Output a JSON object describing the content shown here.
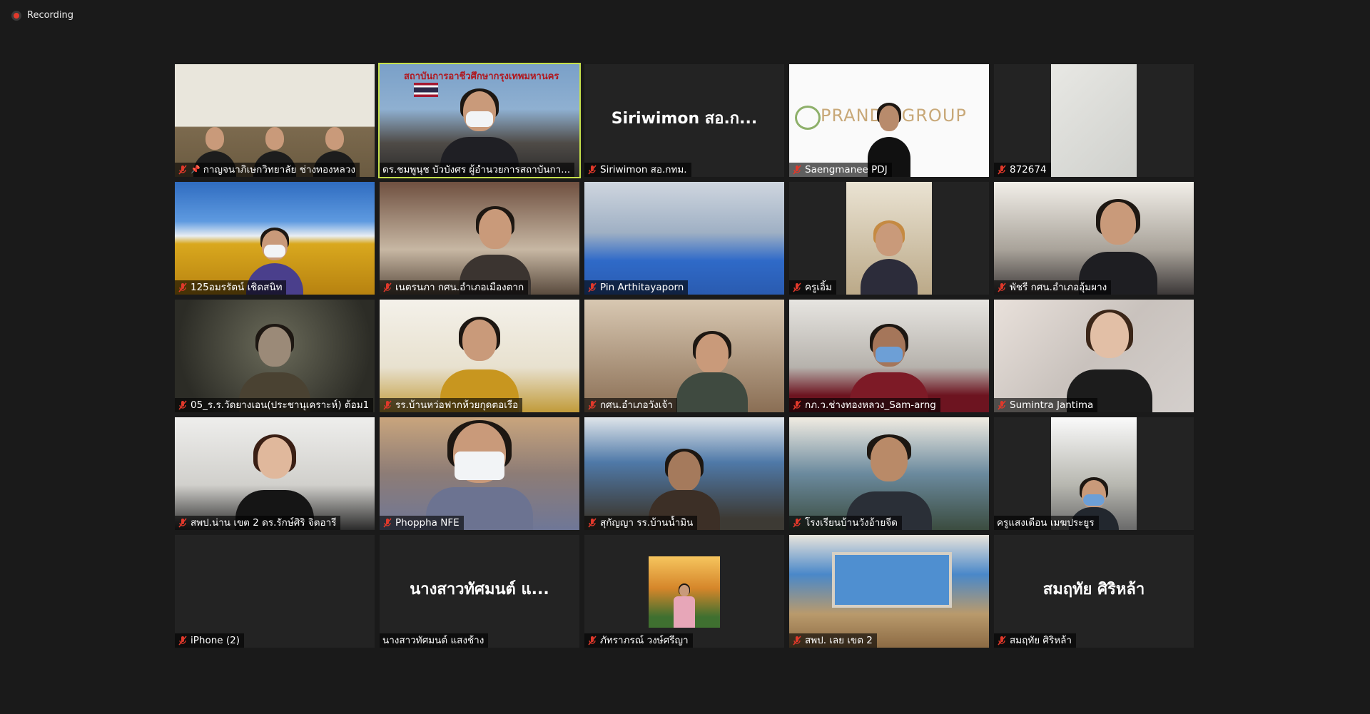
{
  "recording": {
    "label": "Recording",
    "icon": "record-dot-icon",
    "color": "#e0392b"
  },
  "active_speaker_color": "#c6e04a",
  "tiles": [
    {
      "name": "กาญจนาภิเษกวิทยาลัย ช่างทองหลวง",
      "muted": true,
      "pinned": true,
      "video": "meeting-stage"
    },
    {
      "name": "ดร.ชมพูนุช บัวบังศร ผู้อำนวยการสถาบันกา...",
      "muted": false,
      "active": true,
      "video": "speaker-thai-flag",
      "banner": "สถาบันการอาชีวศึกษากรุงเทพมหานคร"
    },
    {
      "name": "Siriwimon สอ.กทม.",
      "muted": true,
      "display_name": "Siriwimon สอ.ก...",
      "video": "none"
    },
    {
      "name": "Saengmanee PDJ",
      "muted": true,
      "video": "pranda-group",
      "logo": "PRANDA GROUP"
    },
    {
      "name": "872674",
      "muted": true,
      "video": "ceiling"
    },
    {
      "name": "125อมรรัตน์ เชิดสนิท",
      "muted": true,
      "video": "sunflower"
    },
    {
      "name": "เนตรนภา กศน.อำเภอเมืองตาก",
      "muted": true,
      "video": "office"
    },
    {
      "name": "Pin Arthitayaporn",
      "muted": true,
      "video": "library"
    },
    {
      "name": "ครูเอิ้ม",
      "muted": true,
      "video": "room"
    },
    {
      "name": "พัชรี กศน.อำเภออุ้มผาง",
      "muted": true,
      "video": "room-glasses"
    },
    {
      "name": "05_ร.ร.วัดยางเอน(ประชานุเคราะห์) ต้อม1",
      "muted": true,
      "video": "blurred"
    },
    {
      "name": "รร.บ้านหว่อฟากห้วยกุดตอเรือ",
      "muted": true,
      "video": "tree-wall"
    },
    {
      "name": "กศน.อำเภอวังเจ้า",
      "muted": true,
      "video": "poster-room"
    },
    {
      "name": "กภ.ว.ช่างทองหลวง_Sam-arng",
      "muted": true,
      "video": "office-chair"
    },
    {
      "name": "Sumintra Jantima",
      "muted": true,
      "video": "red-wall"
    },
    {
      "name": "สพป.น่าน เขต 2 ดร.รักษ์ศิริ จิตอารี",
      "muted": true,
      "video": "woman-white"
    },
    {
      "name": "Phoppha NFE",
      "muted": true,
      "video": "glasses-mask"
    },
    {
      "name": "สุกัญญา รร.บ้านน้ำมิน",
      "muted": true,
      "video": "blue-room"
    },
    {
      "name": "โรงเรียนบ้านวังอ้ายจีด",
      "muted": true,
      "video": "classroom"
    },
    {
      "name": "ครูแสงเดือน เมฆประยูร",
      "muted": false,
      "video": "ceiling-mask"
    },
    {
      "name": "iPhone (2)",
      "muted": true,
      "video": "none-blank"
    },
    {
      "name": "นางสาวทัศมนต์ แสงช้าง",
      "muted": false,
      "display_name": "นางสาวทัศมนต์ แ...",
      "video": "none"
    },
    {
      "name": "ภัทราภรณ์ วงษ์ศรีญา",
      "muted": true,
      "video": "sunset-avatar"
    },
    {
      "name": "สพป. เลย เขต 2",
      "muted": true,
      "video": "hall"
    },
    {
      "name": "สมฤทัย ศิริหล้า",
      "muted": true,
      "display_name": "สมฤทัย ศิริหล้า",
      "video": "none"
    }
  ]
}
